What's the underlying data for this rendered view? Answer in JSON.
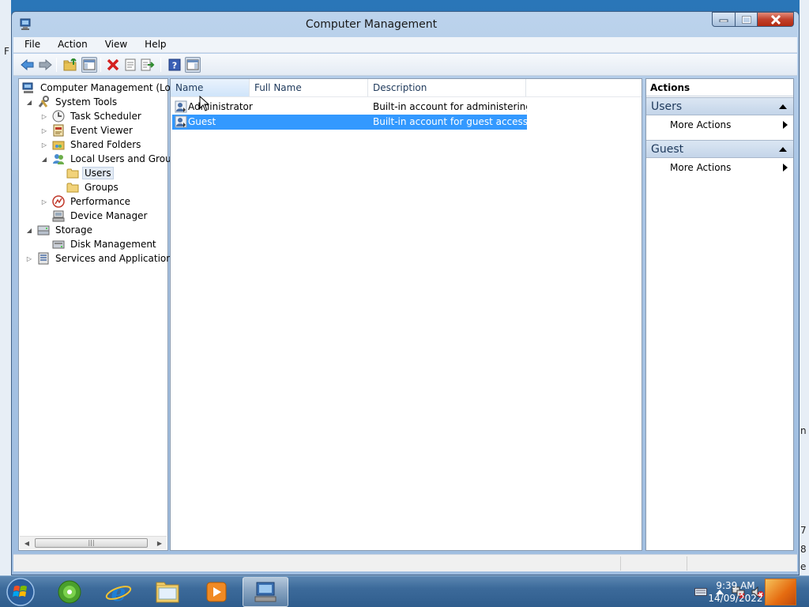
{
  "window": {
    "title": "Computer Management",
    "caption_buttons": [
      "minimize-icon",
      "maximize-icon",
      "close-icon"
    ]
  },
  "menu": {
    "items": [
      "File",
      "Action",
      "View",
      "Help"
    ]
  },
  "toolbar": {
    "buttons": [
      "back-arrow-icon",
      "forward-arrow-icon",
      "up-folder-icon",
      "show-hide-tree-icon",
      "delete-icon",
      "properties-icon",
      "export-list-icon",
      "help-icon",
      "show-hide-action-pane-icon"
    ]
  },
  "tree": {
    "items": [
      {
        "label": "Computer Management (Local",
        "level": 0,
        "expander": "",
        "icon": "computer-management-icon"
      },
      {
        "label": "System Tools",
        "level": 1,
        "expander": "expanded",
        "icon": "system-tools-icon"
      },
      {
        "label": "Task Scheduler",
        "level": 2,
        "expander": "collapsed",
        "icon": "clock-icon"
      },
      {
        "label": "Event Viewer",
        "level": 2,
        "expander": "collapsed",
        "icon": "event-viewer-icon"
      },
      {
        "label": "Shared Folders",
        "level": 2,
        "expander": "collapsed",
        "icon": "shared-folder-icon"
      },
      {
        "label": "Local Users and Groups",
        "level": 2,
        "expander": "expanded",
        "icon": "users-groups-icon"
      },
      {
        "label": "Users",
        "level": 3,
        "expander": "",
        "icon": "folder-icon",
        "selected": true
      },
      {
        "label": "Groups",
        "level": 3,
        "expander": "",
        "icon": "folder-icon"
      },
      {
        "label": "Performance",
        "level": 2,
        "expander": "collapsed",
        "icon": "performance-icon"
      },
      {
        "label": "Device Manager",
        "level": 2,
        "expander": "",
        "icon": "device-manager-icon"
      },
      {
        "label": "Storage",
        "level": 1,
        "expander": "expanded",
        "icon": "storage-icon"
      },
      {
        "label": "Disk Management",
        "level": 2,
        "expander": "",
        "icon": "disk-icon"
      },
      {
        "label": "Services and Applications",
        "level": 1,
        "expander": "collapsed",
        "icon": "services-icon"
      }
    ],
    "scrollbar_grip": "|||"
  },
  "list": {
    "columns": [
      "Name",
      "Full Name",
      "Description"
    ],
    "rows": [
      {
        "name": "Administrator",
        "full_name": "",
        "description": "Built-in account for administering...",
        "icon": "user-account-icon",
        "selected": false
      },
      {
        "name": "Guest",
        "full_name": "",
        "description": "Built-in account for guest access t...",
        "icon": "user-account-icon",
        "selected": true
      }
    ]
  },
  "actions": {
    "header": "Actions",
    "sections": [
      {
        "title": "Users",
        "items": [
          "More Actions"
        ]
      },
      {
        "title": "Guest",
        "items": [
          "More Actions"
        ]
      }
    ]
  },
  "taskbar": {
    "apps": [
      "start-orb-icon",
      "windows-media-center-icon",
      "internet-explorer-icon",
      "windows-explorer-icon",
      "windows-media-player-icon",
      "computer-management-icon"
    ],
    "tray_icons": [
      "keyboard-icon",
      "show-hidden-icons-icon",
      "network-icon",
      "volume-muted-icon"
    ],
    "time": "9:39 AM",
    "date": "14/09/2022"
  },
  "desktop": {
    "edge_chars": [
      "F",
      "n",
      "7",
      "8",
      "e"
    ]
  },
  "colors": {
    "selection": "#3399ff",
    "accent": "#1e395b"
  }
}
